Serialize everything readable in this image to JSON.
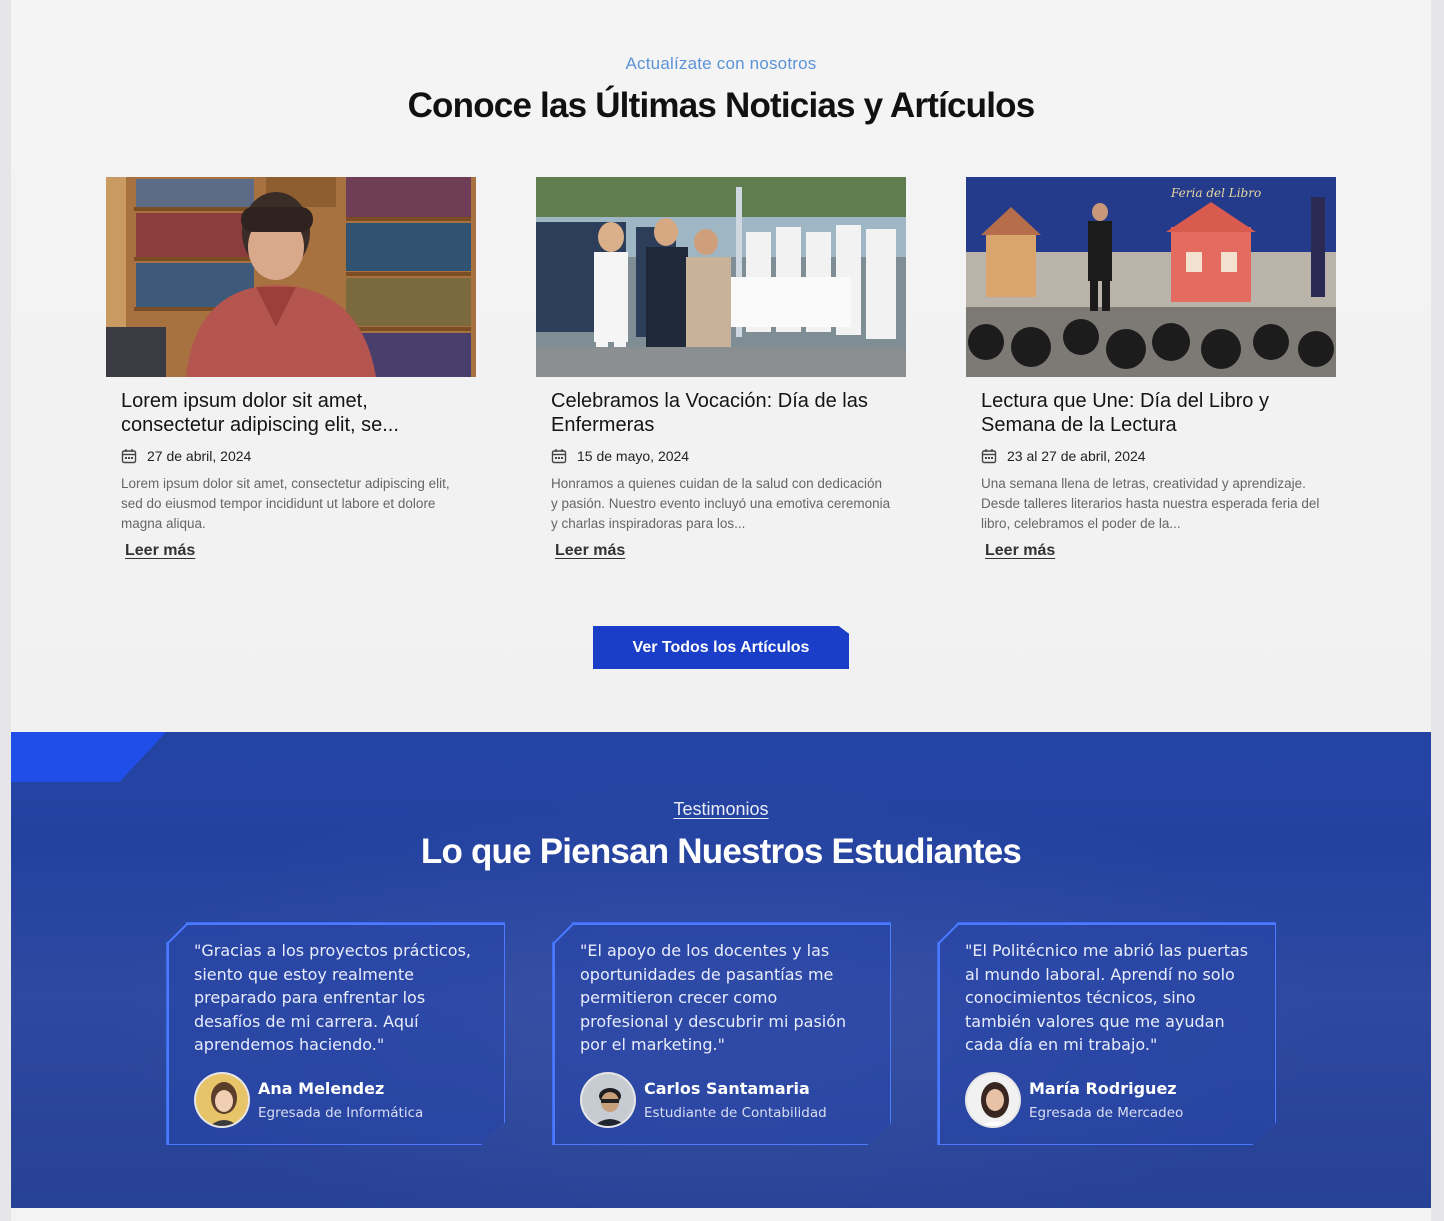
{
  "news": {
    "eyebrow": "Actualízate con nosotros",
    "title": "Conoce las Últimas Noticias y Artículos",
    "articles": [
      {
        "title": "Lorem ipsum dolor sit amet, consectetur adipiscing elit, se...",
        "date": "27 de abril, 2024",
        "excerpt": "Lorem ipsum dolor sit amet, consectetur adipiscing elit, sed do eiusmod tempor incididunt ut labore et dolore magna aliqua.",
        "link": "Leer más"
      },
      {
        "title": "Celebramos la Vocación: Día de las Enfermeras",
        "date": "15 de mayo, 2024",
        "excerpt": "Honramos a quienes cuidan de la salud con dedicación y pasión. Nuestro evento incluyó una emotiva ceremonia y charlas inspiradoras para los...",
        "link": "Leer más"
      },
      {
        "title": "Lectura que Une: Día del Libro y Semana de la Lectura",
        "date": "23 al 27 de abril, 2024",
        "excerpt": "Una semana llena de letras, creatividad y aprendizaje. Desde talleres literarios hasta nuestra esperada feria del libro, celebramos el poder de la...",
        "link": "Leer más"
      }
    ],
    "cta": "Ver Todos los Artículos"
  },
  "testimonials": {
    "eyebrow": "Testimonios",
    "title": "Lo que Piensan Nuestros Estudiantes",
    "items": [
      {
        "quote": "\"Gracias a los proyectos prácticos, siento que estoy realmente preparado para enfrentar los desafíos de mi carrera. Aquí aprendemos haciendo.\"",
        "name": "Ana Melendez",
        "role": "Egresada de Informática"
      },
      {
        "quote": "\"El apoyo de los docentes y las oportunidades de pasantías me permitieron crecer como profesional y descubrir mi pasión por el marketing.\"",
        "name": "Carlos Santamaria",
        "role": "Estudiante de Contabilidad"
      },
      {
        "quote": "\"El Politécnico me abrió las puertas al mundo laboral. Aprendí no solo conocimientos técnicos, sino también valores que me ayudan cada día en mi trabajo.\"",
        "name": "María Rodriguez",
        "role": "Egresada de Mercadeo"
      }
    ]
  },
  "colors": {
    "accent_blue": "#1a3ec8",
    "section_blue": "#2444a4",
    "eyebrow_blue": "#5c93d6"
  }
}
